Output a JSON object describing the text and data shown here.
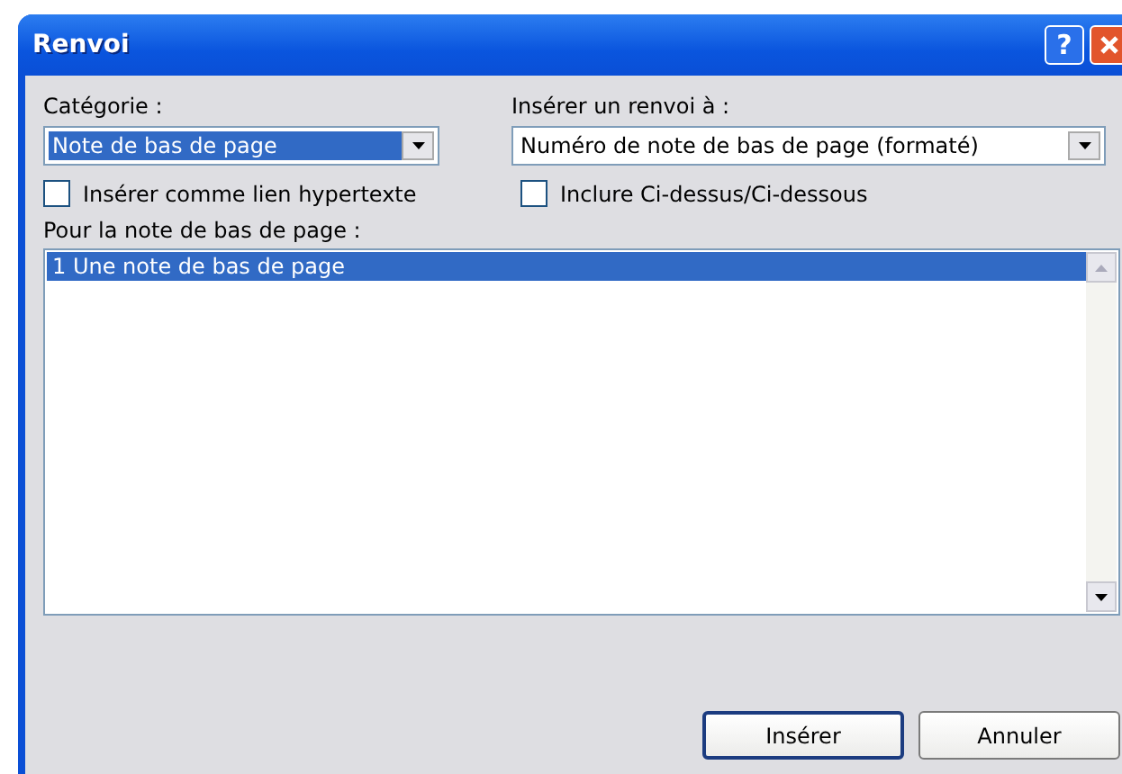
{
  "window": {
    "title": "Renvoi",
    "help_button": "?"
  },
  "category": {
    "label": "Catégorie :",
    "value": "Note de bas de page"
  },
  "reference_type": {
    "label": "Insérer un renvoi à :",
    "value": "Numéro de note de bas de page (formaté)"
  },
  "checkboxes": [
    {
      "label": "Insérer comme lien hypertexte",
      "checked": false
    },
    {
      "label": "Inclure Ci-dessus/Ci-dessous",
      "checked": false
    }
  ],
  "list": {
    "label": "Pour la note de bas de page :",
    "items": [
      {
        "text": "1 Une note de bas de page",
        "selected": true
      }
    ]
  },
  "buttons": [
    {
      "label": "Insérer",
      "default": true
    },
    {
      "label": "Annuler",
      "default": false
    }
  ]
}
